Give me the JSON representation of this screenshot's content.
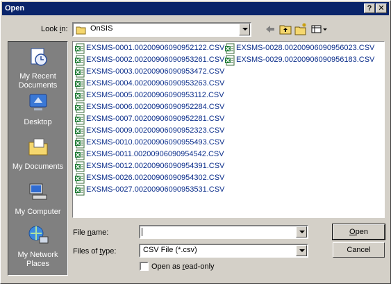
{
  "window": {
    "title": "Open",
    "help_label": "?",
    "close_label": "✕"
  },
  "lookin": {
    "label": "Look in:",
    "value": "OnSIS"
  },
  "toolbar": {
    "icons": [
      "back-icon",
      "up-folder-icon",
      "new-folder-icon",
      "views-menu-icon"
    ]
  },
  "places": [
    {
      "label": "My Recent Documents",
      "icon": "recent-documents-icon"
    },
    {
      "label": "Desktop",
      "icon": "desktop-icon"
    },
    {
      "label": "My Documents",
      "icon": "my-documents-icon"
    },
    {
      "label": "My Computer",
      "icon": "my-computer-icon"
    },
    {
      "label": "My Network Places",
      "icon": "network-places-icon"
    }
  ],
  "files": [
    "EXSMS-0001.00200906090952122.CSV",
    "EXSMS-0002.00200906090953261.CSV",
    "EXSMS-0003.00200906090953472.CSV",
    "EXSMS-0004.00200906090953263.CSV",
    "EXSMS-0005.00200906090953112.CSV",
    "EXSMS-0006.00200906090952284.CSV",
    "EXSMS-0007.00200906090952281.CSV",
    "EXSMS-0009.00200906090952323.CSV",
    "EXSMS-0010.00200906090955493.CSV",
    "EXSMS-0011.00200906090954542.CSV",
    "EXSMS-0012.00200906090954391.CSV",
    "EXSMS-0026.00200906090954302.CSV",
    "EXSMS-0027.00200906090953531.CSV",
    "EXSMS-0028.00200906090956023.CSV",
    "EXSMS-0029.00200906090956183.CSV"
  ],
  "filename": {
    "label": "File name:",
    "value": ""
  },
  "filetype": {
    "label": "Files of type:",
    "value": "CSV File (*.csv)"
  },
  "readonly": {
    "label": "Open as read-only",
    "checked": false
  },
  "buttons": {
    "open": "Open",
    "cancel": "Cancel"
  },
  "colors": {
    "titlebar": "#0a246a",
    "dialog": "#d4d0c8",
    "places_bar": "#808080",
    "file_text": "#0b2e8b"
  }
}
